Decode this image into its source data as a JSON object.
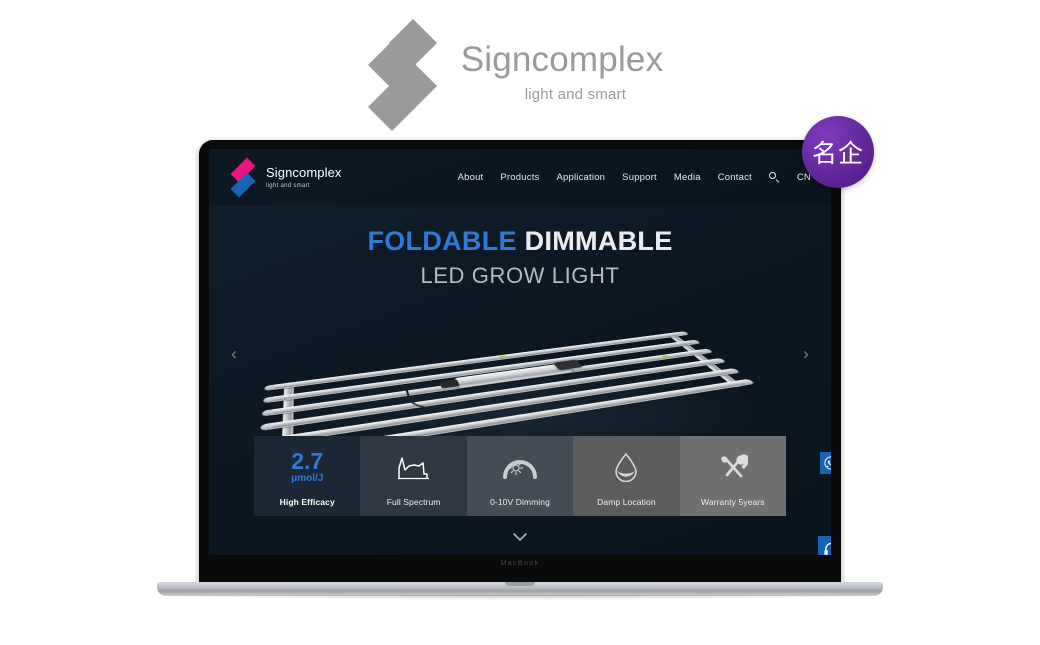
{
  "brand": {
    "name": "Signcomplex",
    "tagline": "light and smart",
    "logo_icon": "diamond-stack-icon"
  },
  "badge": {
    "text": "名企",
    "color": "#5b2191"
  },
  "laptop": {
    "model_label": "MacBook"
  },
  "site": {
    "logo_name": "Signcomplex",
    "logo_tagline": "light and smart",
    "nav": [
      {
        "label": "About",
        "name": "nav-link-about"
      },
      {
        "label": "Products",
        "name": "nav-link-products"
      },
      {
        "label": "Application",
        "name": "nav-link-application"
      },
      {
        "label": "Support",
        "name": "nav-link-support"
      },
      {
        "label": "Media",
        "name": "nav-link-media"
      },
      {
        "label": "Contact",
        "name": "nav-link-contact"
      }
    ],
    "search_icon": "search-icon",
    "language": "CN"
  },
  "hero": {
    "word_foldable": "FOLDABLE",
    "word_dimmable": "DIMMABLE",
    "subtitle": "LED GROW LIGHT",
    "foldable_color": "#2e7ad6",
    "product_icon": "led-grow-light-image",
    "prev_arrow": "‹",
    "next_arrow": "›",
    "scroll_chevron": "⌄"
  },
  "features": [
    {
      "name": "feature-high-efficacy",
      "value": "2.7",
      "unit": "μmol/J",
      "label": "High Efficacy",
      "icon": "efficacy-number",
      "bg": "#1b2735"
    },
    {
      "name": "feature-full-spectrum",
      "label": "Full Spectrum",
      "icon": "spectrum-chart-icon",
      "bg": "#2e3742"
    },
    {
      "name": "feature-dimming",
      "label": "0-10V Dimming",
      "icon": "dimmer-gauge-icon",
      "bg": "#454c55"
    },
    {
      "name": "feature-damp-location",
      "label": "Damp Location",
      "icon": "water-droplet-icon",
      "bg": "#5a5c5e"
    },
    {
      "name": "feature-warranty",
      "label": "Warranty 5years",
      "icon": "tools-icon",
      "bg": "#6e7072"
    }
  ],
  "side_buttons": [
    {
      "name": "whatsapp-button",
      "icon": "whatsapp-icon",
      "color": "#1763b5"
    },
    {
      "name": "support-chat-button",
      "icon": "headset-icon",
      "color": "#1763b5"
    }
  ]
}
